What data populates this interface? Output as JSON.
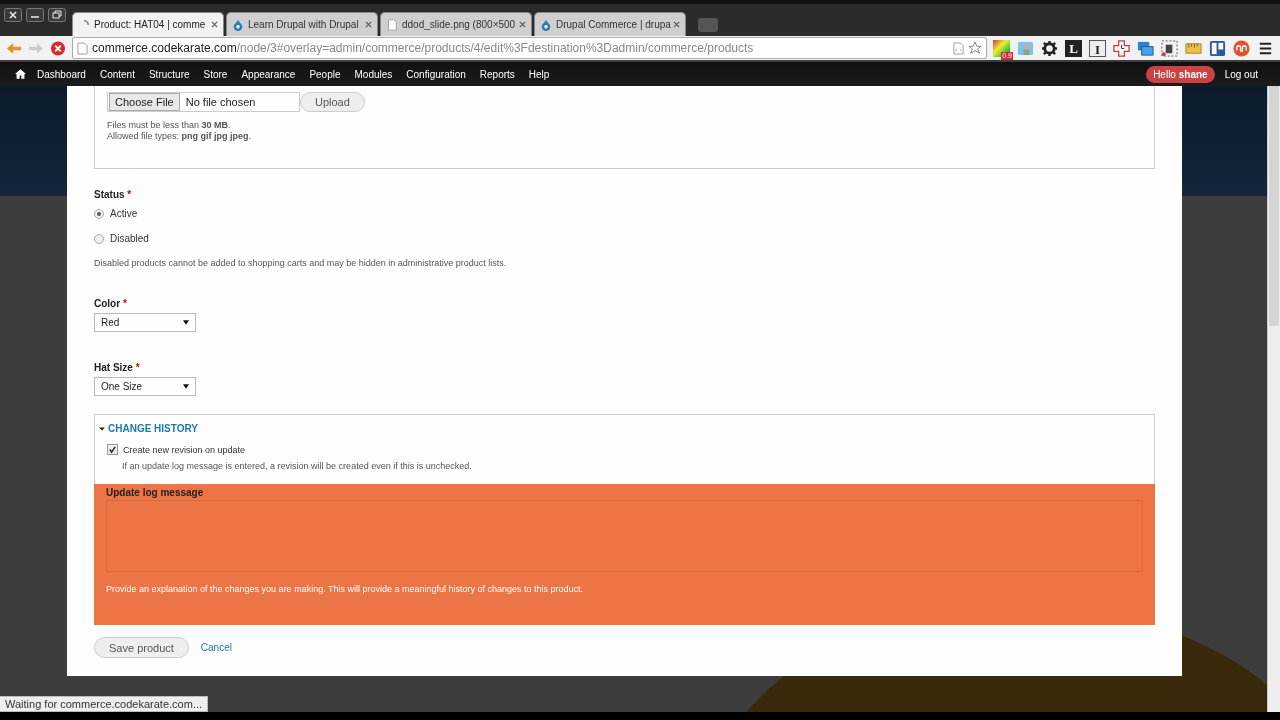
{
  "browser": {
    "tabs": [
      {
        "title": "Product: HAT04 | comme",
        "kind": "loading",
        "selected": true
      },
      {
        "title": "Learn Drupal with Drupal",
        "kind": "drupal",
        "selected": false
      },
      {
        "title": "ddod_slide.png (800×500",
        "kind": "file",
        "selected": false
      },
      {
        "title": "Drupal Commerce | drupa",
        "kind": "drupal",
        "selected": false
      }
    ],
    "address": {
      "host": "commerce.codekarate.com",
      "path": "/node/3#overlay=admin/commerce/products/4/edit%3Fdestination%3Dadmin/commerce/products"
    },
    "extensions": [
      {
        "kind": "gradient",
        "badge": "0.9"
      },
      {
        "kind": "photo"
      },
      {
        "kind": "gear"
      },
      {
        "kind": "letter",
        "text": "L"
      },
      {
        "kind": "letter-outline",
        "text": "I"
      },
      {
        "kind": "cross"
      },
      {
        "kind": "screens"
      },
      {
        "kind": "clip"
      },
      {
        "kind": "ruler"
      },
      {
        "kind": "board"
      },
      {
        "kind": "stumble"
      }
    ]
  },
  "toolbar": {
    "items": [
      "Dashboard",
      "Content",
      "Structure",
      "Store",
      "Appearance",
      "People",
      "Modules",
      "Configuration",
      "Reports",
      "Help"
    ],
    "greeting": "Hello **shane**",
    "logout": "Log out"
  },
  "form": {
    "file": {
      "button": "Choose File",
      "value": "No file chosen",
      "upload": "Upload",
      "help": [
        "Files must be less than **30 MB**.",
        "Allowed file types: **png gif jpg jpeg**."
      ]
    },
    "status": {
      "label": "Status",
      "required_mark": "*",
      "options": [
        {
          "label": "Active",
          "selected": true
        },
        {
          "label": "Disabled",
          "selected": false
        }
      ],
      "description": "Disabled products cannot be added to shopping carts and may be hidden in administrative product lists."
    },
    "selects": [
      {
        "label": "Color",
        "required_mark": "*",
        "value": "Red"
      },
      {
        "label": "Hat Size",
        "required_mark": "*",
        "value": "One Size"
      }
    ],
    "change_history": {
      "legend": "CHANGE HISTORY",
      "expanded": true,
      "revision": {
        "label": "Create new revision on update",
        "checked": true
      },
      "revision_help": "If an update log message is entered, a revision will be created even if this is unchecked.",
      "log_label": "Update log message",
      "log_help": "Provide an explanation of the changes you are making. This will provide a meaningful history of changes to this product."
    },
    "actions": {
      "save": "Save product",
      "cancel": "Cancel"
    }
  },
  "status_bar": "Waiting for commerce.codekarate.com..."
}
